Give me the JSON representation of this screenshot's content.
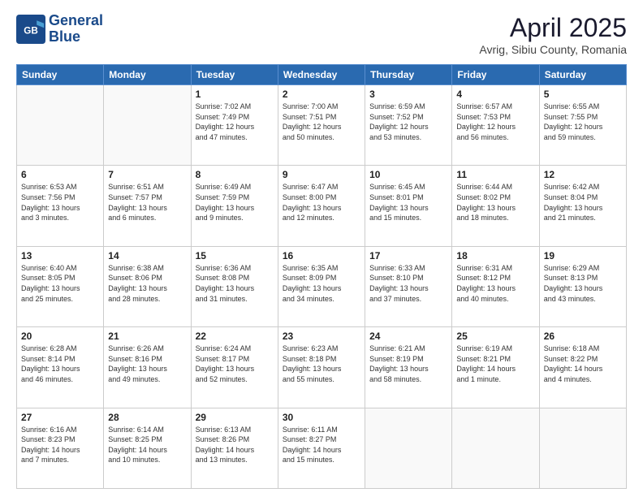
{
  "header": {
    "logo_line1": "General",
    "logo_line2": "Blue",
    "title": "April 2025",
    "subtitle": "Avrig, Sibiu County, Romania"
  },
  "calendar": {
    "days_of_week": [
      "Sunday",
      "Monday",
      "Tuesday",
      "Wednesday",
      "Thursday",
      "Friday",
      "Saturday"
    ],
    "weeks": [
      [
        {
          "day": "",
          "info": ""
        },
        {
          "day": "",
          "info": ""
        },
        {
          "day": "1",
          "info": "Sunrise: 7:02 AM\nSunset: 7:49 PM\nDaylight: 12 hours\nand 47 minutes."
        },
        {
          "day": "2",
          "info": "Sunrise: 7:00 AM\nSunset: 7:51 PM\nDaylight: 12 hours\nand 50 minutes."
        },
        {
          "day": "3",
          "info": "Sunrise: 6:59 AM\nSunset: 7:52 PM\nDaylight: 12 hours\nand 53 minutes."
        },
        {
          "day": "4",
          "info": "Sunrise: 6:57 AM\nSunset: 7:53 PM\nDaylight: 12 hours\nand 56 minutes."
        },
        {
          "day": "5",
          "info": "Sunrise: 6:55 AM\nSunset: 7:55 PM\nDaylight: 12 hours\nand 59 minutes."
        }
      ],
      [
        {
          "day": "6",
          "info": "Sunrise: 6:53 AM\nSunset: 7:56 PM\nDaylight: 13 hours\nand 3 minutes."
        },
        {
          "day": "7",
          "info": "Sunrise: 6:51 AM\nSunset: 7:57 PM\nDaylight: 13 hours\nand 6 minutes."
        },
        {
          "day": "8",
          "info": "Sunrise: 6:49 AM\nSunset: 7:59 PM\nDaylight: 13 hours\nand 9 minutes."
        },
        {
          "day": "9",
          "info": "Sunrise: 6:47 AM\nSunset: 8:00 PM\nDaylight: 13 hours\nand 12 minutes."
        },
        {
          "day": "10",
          "info": "Sunrise: 6:45 AM\nSunset: 8:01 PM\nDaylight: 13 hours\nand 15 minutes."
        },
        {
          "day": "11",
          "info": "Sunrise: 6:44 AM\nSunset: 8:02 PM\nDaylight: 13 hours\nand 18 minutes."
        },
        {
          "day": "12",
          "info": "Sunrise: 6:42 AM\nSunset: 8:04 PM\nDaylight: 13 hours\nand 21 minutes."
        }
      ],
      [
        {
          "day": "13",
          "info": "Sunrise: 6:40 AM\nSunset: 8:05 PM\nDaylight: 13 hours\nand 25 minutes."
        },
        {
          "day": "14",
          "info": "Sunrise: 6:38 AM\nSunset: 8:06 PM\nDaylight: 13 hours\nand 28 minutes."
        },
        {
          "day": "15",
          "info": "Sunrise: 6:36 AM\nSunset: 8:08 PM\nDaylight: 13 hours\nand 31 minutes."
        },
        {
          "day": "16",
          "info": "Sunrise: 6:35 AM\nSunset: 8:09 PM\nDaylight: 13 hours\nand 34 minutes."
        },
        {
          "day": "17",
          "info": "Sunrise: 6:33 AM\nSunset: 8:10 PM\nDaylight: 13 hours\nand 37 minutes."
        },
        {
          "day": "18",
          "info": "Sunrise: 6:31 AM\nSunset: 8:12 PM\nDaylight: 13 hours\nand 40 minutes."
        },
        {
          "day": "19",
          "info": "Sunrise: 6:29 AM\nSunset: 8:13 PM\nDaylight: 13 hours\nand 43 minutes."
        }
      ],
      [
        {
          "day": "20",
          "info": "Sunrise: 6:28 AM\nSunset: 8:14 PM\nDaylight: 13 hours\nand 46 minutes."
        },
        {
          "day": "21",
          "info": "Sunrise: 6:26 AM\nSunset: 8:16 PM\nDaylight: 13 hours\nand 49 minutes."
        },
        {
          "day": "22",
          "info": "Sunrise: 6:24 AM\nSunset: 8:17 PM\nDaylight: 13 hours\nand 52 minutes."
        },
        {
          "day": "23",
          "info": "Sunrise: 6:23 AM\nSunset: 8:18 PM\nDaylight: 13 hours\nand 55 minutes."
        },
        {
          "day": "24",
          "info": "Sunrise: 6:21 AM\nSunset: 8:19 PM\nDaylight: 13 hours\nand 58 minutes."
        },
        {
          "day": "25",
          "info": "Sunrise: 6:19 AM\nSunset: 8:21 PM\nDaylight: 14 hours\nand 1 minute."
        },
        {
          "day": "26",
          "info": "Sunrise: 6:18 AM\nSunset: 8:22 PM\nDaylight: 14 hours\nand 4 minutes."
        }
      ],
      [
        {
          "day": "27",
          "info": "Sunrise: 6:16 AM\nSunset: 8:23 PM\nDaylight: 14 hours\nand 7 minutes."
        },
        {
          "day": "28",
          "info": "Sunrise: 6:14 AM\nSunset: 8:25 PM\nDaylight: 14 hours\nand 10 minutes."
        },
        {
          "day": "29",
          "info": "Sunrise: 6:13 AM\nSunset: 8:26 PM\nDaylight: 14 hours\nand 13 minutes."
        },
        {
          "day": "30",
          "info": "Sunrise: 6:11 AM\nSunset: 8:27 PM\nDaylight: 14 hours\nand 15 minutes."
        },
        {
          "day": "",
          "info": ""
        },
        {
          "day": "",
          "info": ""
        },
        {
          "day": "",
          "info": ""
        }
      ]
    ]
  }
}
